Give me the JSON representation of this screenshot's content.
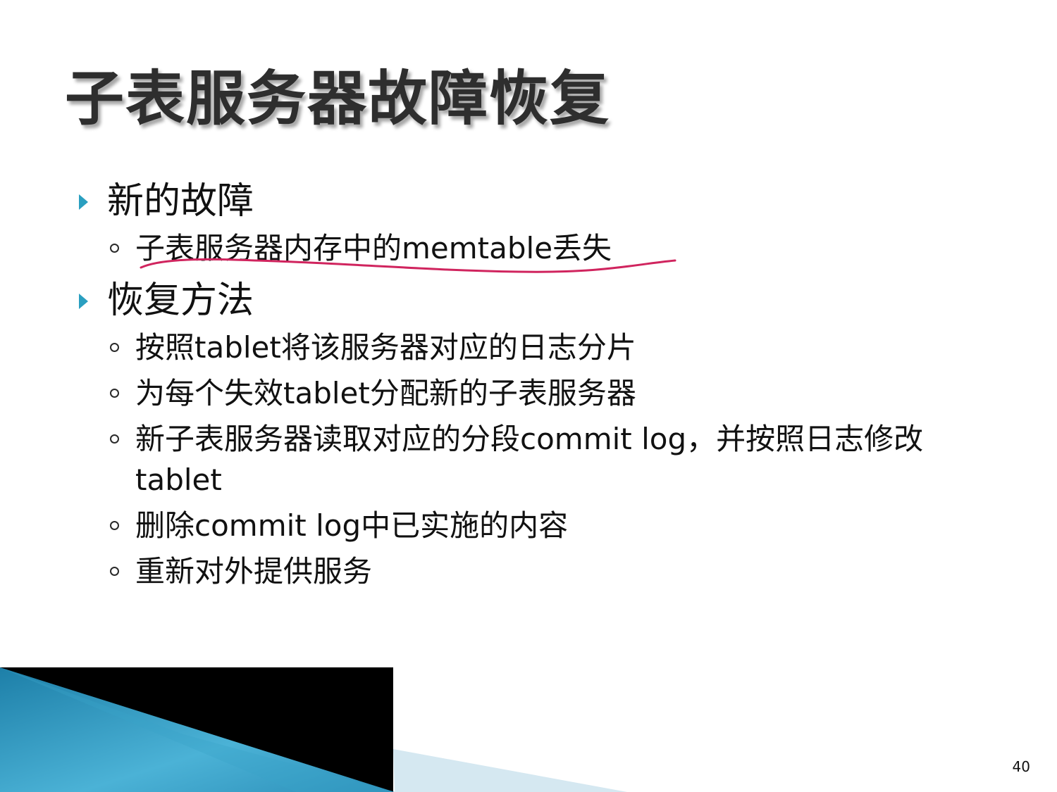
{
  "slide": {
    "title": "子表服务器故障恢复",
    "sections": [
      {
        "heading": "新的故障",
        "items": [
          "子表服务器内存中的memtable丢失"
        ]
      },
      {
        "heading": "恢复方法",
        "items": [
          "按照tablet将该服务器对应的日志分片",
          "为每个失效tablet分配新的子表服务器",
          "新子表服务器读取对应的分段commit log，并按照日志修改tablet",
          "删除commit log中已实施的内容",
          "重新对外提供服务"
        ]
      }
    ],
    "page_number": "40"
  },
  "colors": {
    "bullet_accent": "#2a9fc0",
    "underline_annotation": "#d0245e",
    "footer_blue": "#3a9ec4",
    "footer_black": "#000000"
  }
}
